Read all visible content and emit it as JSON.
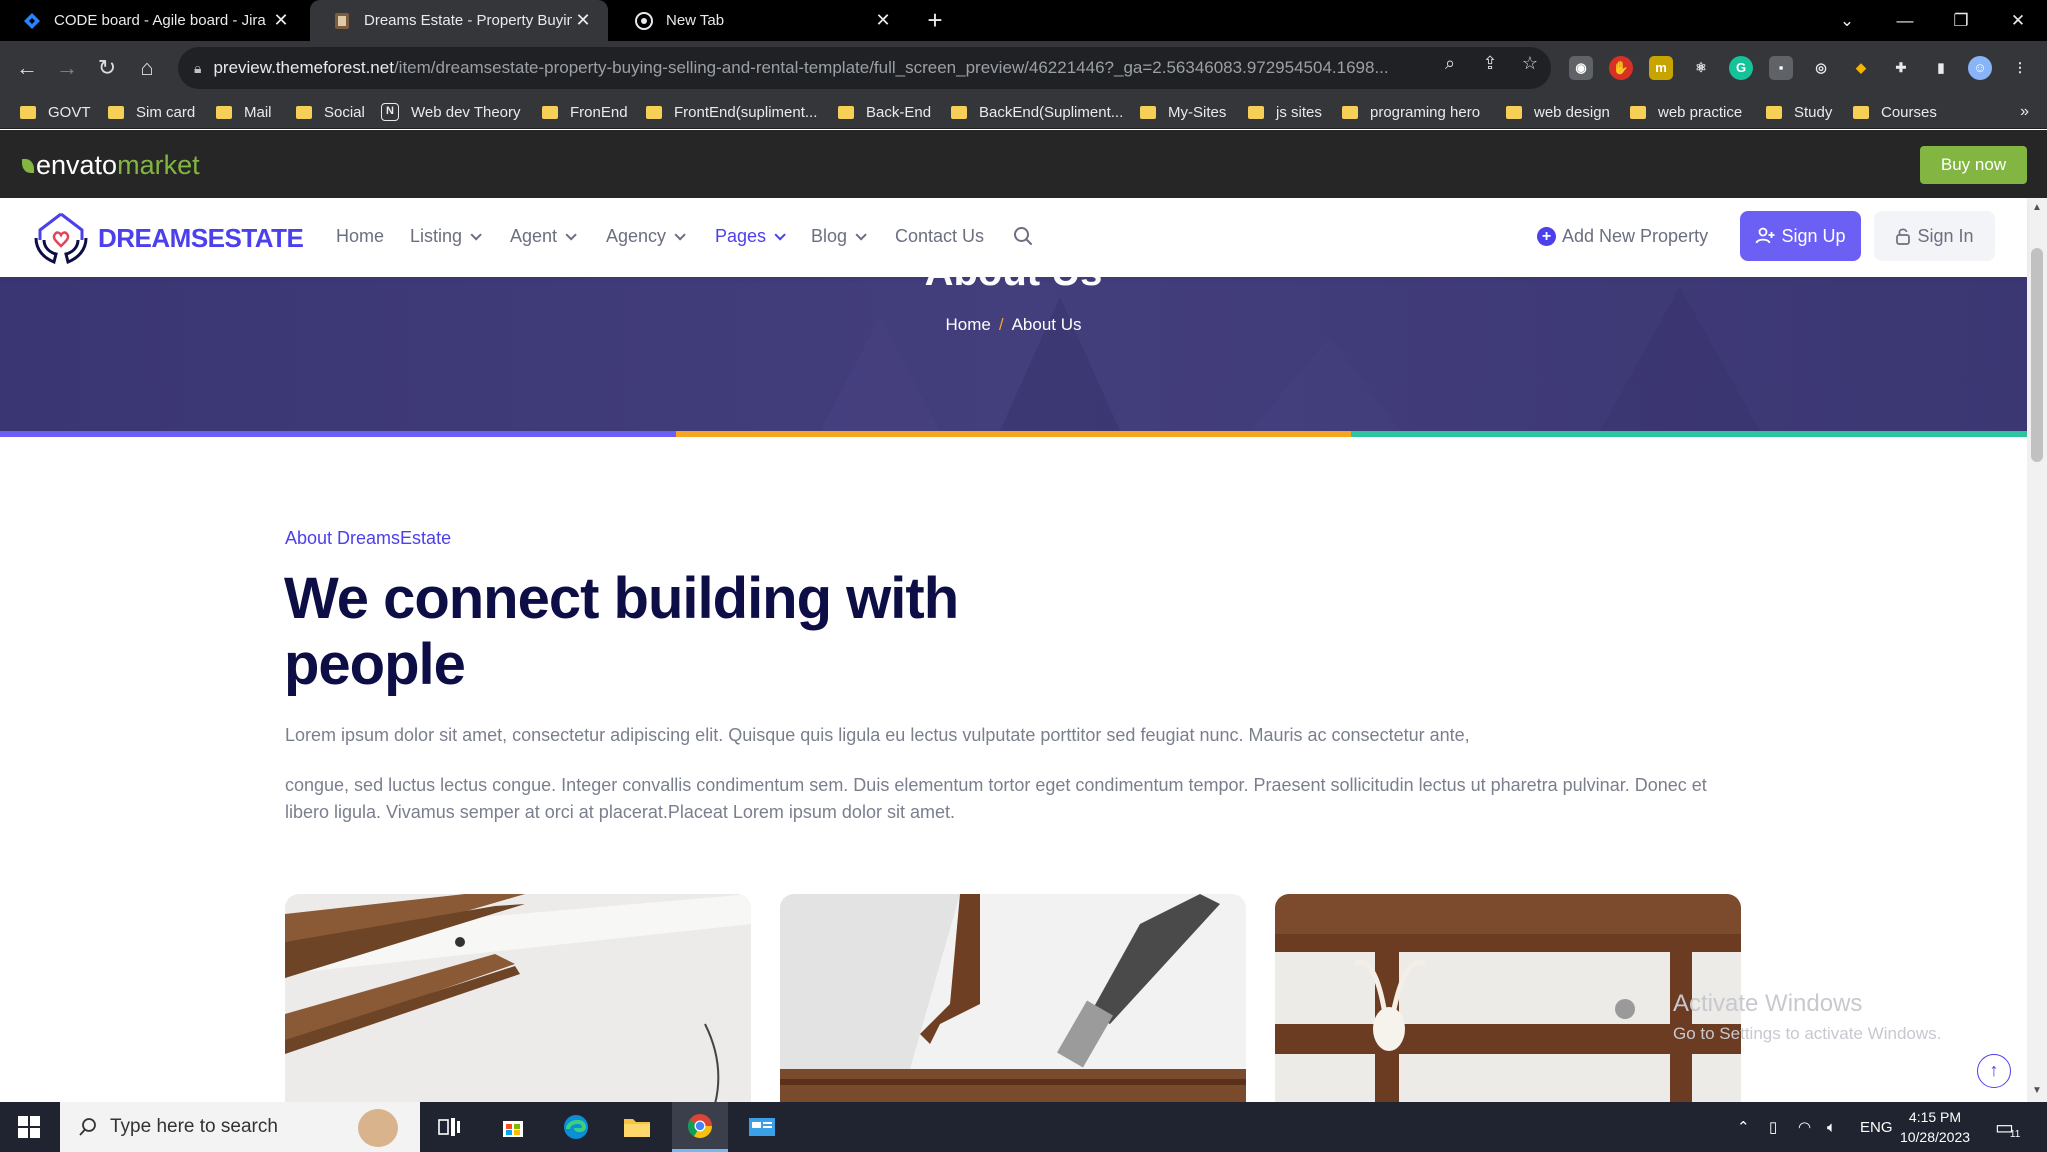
{
  "browser": {
    "tabs": [
      {
        "title": "CODE board - Agile board - Jira",
        "icon": "jira-icon",
        "active": false
      },
      {
        "title": "Dreams Estate - Property Buying",
        "icon": "site-favicon",
        "active": true
      },
      {
        "title": "New Tab",
        "icon": "chrome-icon",
        "active": false
      }
    ],
    "url_host": "preview.themeforest.net",
    "url_path": "/item/dreamsestate-property-buying-selling-and-rental-template/full_screen_preview/46221446?_ga=2.56346083.972954504.1698...",
    "bookmarks": [
      {
        "label": "GOVT",
        "icon": "folder-icon"
      },
      {
        "label": "Sim card",
        "icon": "folder-icon"
      },
      {
        "label": "Mail",
        "icon": "folder-icon"
      },
      {
        "label": "Social",
        "icon": "folder-icon"
      },
      {
        "label": "Web dev Theory",
        "icon": "notion-icon"
      },
      {
        "label": "FronEnd",
        "icon": "folder-icon"
      },
      {
        "label": "FrontEnd(supliment...",
        "icon": "folder-icon"
      },
      {
        "label": "Back-End",
        "icon": "folder-icon"
      },
      {
        "label": "BackEnd(Supliment...",
        "icon": "folder-icon"
      },
      {
        "label": "My-Sites",
        "icon": "folder-icon"
      },
      {
        "label": "js sites",
        "icon": "folder-icon"
      },
      {
        "label": "programing hero",
        "icon": "folder-icon"
      },
      {
        "label": "web design",
        "icon": "folder-icon"
      },
      {
        "label": "web practice",
        "icon": "folder-icon"
      },
      {
        "label": "Study",
        "icon": "folder-icon"
      },
      {
        "label": "Courses",
        "icon": "folder-icon"
      }
    ],
    "more_bookmarks": "»"
  },
  "envato": {
    "logo_part1": "envato",
    "logo_part2": "market",
    "buy_now": "Buy now"
  },
  "site": {
    "brand": "DREAMSESTATE",
    "brand_part1": "DREAMS",
    "brand_part2": "ESTATE",
    "nav": [
      {
        "label": "Home",
        "dropdown": false,
        "active": false
      },
      {
        "label": "Listing",
        "dropdown": true,
        "active": false
      },
      {
        "label": "Agent",
        "dropdown": true,
        "active": false
      },
      {
        "label": "Agency",
        "dropdown": true,
        "active": false
      },
      {
        "label": "Pages",
        "dropdown": true,
        "active": true
      },
      {
        "label": "Blog",
        "dropdown": true,
        "active": false
      },
      {
        "label": "Contact Us",
        "dropdown": false,
        "active": false
      }
    ],
    "add_property": "Add New Property",
    "sign_up": "Sign Up",
    "sign_in": "Sign In"
  },
  "banner": {
    "title": "About Us",
    "crumb_home": "Home",
    "crumb_sep": "/",
    "crumb_current": "About Us"
  },
  "about": {
    "tag": "About DreamsEstate",
    "heading": "We connect building with people",
    "para1": "Lorem ipsum dolor sit amet, consectetur adipiscing elit. Quisque quis ligula eu lectus vulputate porttitor sed feugiat nunc. Mauris ac consectetur ante,",
    "para2": "congue, sed luctus lectus congue. Integer convallis condimentum sem. Duis elementum tortor eget condimentum tempor. Praesent sollicitudin lectus ut pharetra pulvinar. Donec et libero ligula. Vivamus semper at orci at placerat.Placeat Lorem ipsum dolor sit amet."
  },
  "watermark": {
    "line1": "Activate Windows",
    "line2": "Go to Settings to activate Windows."
  },
  "taskbar": {
    "search_placeholder": "Type here to search",
    "lang": "ENG",
    "time": "4:15 PM",
    "date": "10/28/2023",
    "notifications": "11"
  },
  "colors": {
    "primary": "#4c40ed",
    "banner": "#3d3976",
    "stripe": [
      "#6c5ff3",
      "#f5a623",
      "#2ec4a0"
    ],
    "envato_green": "#82b541",
    "heading": "#0e0e46"
  }
}
